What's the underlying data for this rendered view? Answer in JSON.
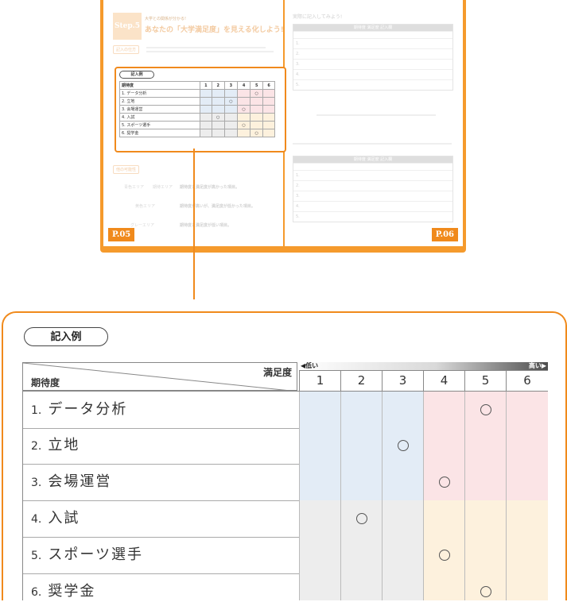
{
  "booklet": {
    "left_page": {
      "step": "Step.5",
      "subtitle": "大学との関係が分かる!",
      "title": "あなたの「大学満足度」を見える化しよう!",
      "pill1": "記入の仕方",
      "pill2": "他の可能性",
      "page_number": "P.05",
      "legend": [
        {
          "tag": "青色エリア",
          "tag2": "期待エリア",
          "text": "期待度と満足度が高かった項目。"
        },
        {
          "tag": "黄色エリア",
          "text": "期待度が高いが、満足度が低かった項目。"
        },
        {
          "tag": "グレーエリア",
          "text": "期待度と満足度が低い項目。"
        }
      ]
    },
    "right_page": {
      "heading": "実際に記入してみよう!",
      "table1_bar": "期待度 満足度 記入欄",
      "table2_bar": "期待度 満足度 記入欄",
      "page_number": "P.06",
      "rows": [
        "1.",
        "2.",
        "3.",
        "4.",
        "5."
      ]
    }
  },
  "example": {
    "label": "記入例",
    "header": {
      "expectation": "期待度",
      "satisfaction": "満足度",
      "low": "◀低い",
      "high": "高い▶",
      "columns": [
        "1",
        "2",
        "3",
        "4",
        "5",
        "6"
      ]
    },
    "rows": [
      {
        "num": "1.",
        "label": "データ分析",
        "mark": 5
      },
      {
        "num": "2.",
        "label": "立地",
        "mark": 3
      },
      {
        "num": "3.",
        "label": "会場運営",
        "mark": 4
      },
      {
        "num": "4.",
        "label": "入試",
        "mark": 2
      },
      {
        "num": "5.",
        "label": "スポーツ選手",
        "mark": 4
      },
      {
        "num": "6.",
        "label": "奨学金",
        "mark": 5
      }
    ],
    "zone_colors": {
      "blue": "#e3ecf6",
      "pink": "#fbe4e6",
      "gray": "#ededed",
      "yellow": "#fdf1dd"
    },
    "zones": [
      [
        "blue",
        "blue",
        "blue",
        "pink",
        "pink",
        "pink"
      ],
      [
        "blue",
        "blue",
        "blue",
        "pink",
        "pink",
        "pink"
      ],
      [
        "blue",
        "blue",
        "blue",
        "pink",
        "pink",
        "pink"
      ],
      [
        "gray",
        "gray",
        "gray",
        "yellow",
        "yellow",
        "yellow"
      ],
      [
        "gray",
        "gray",
        "gray",
        "yellow",
        "yellow",
        "yellow"
      ],
      [
        "gray",
        "gray",
        "gray",
        "yellow",
        "yellow",
        "yellow"
      ]
    ]
  },
  "colors": {
    "accent": "#f08a1c"
  }
}
